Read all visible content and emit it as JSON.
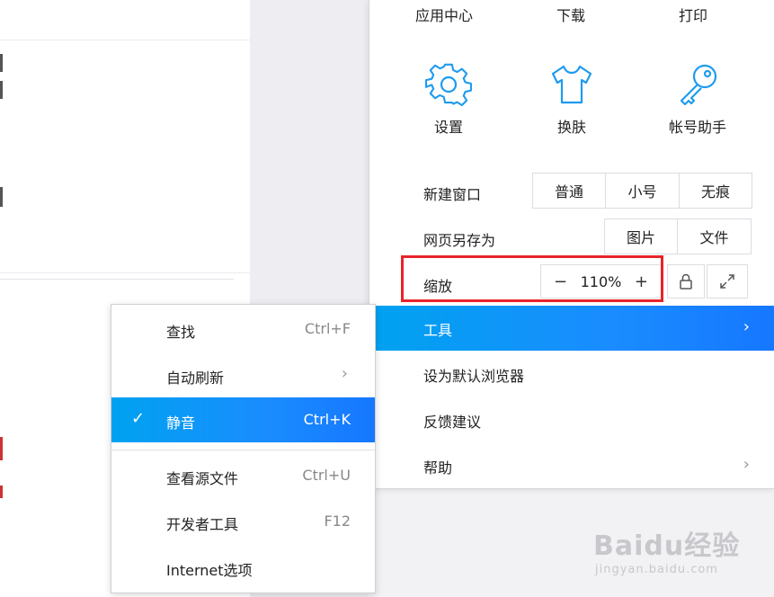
{
  "top_row": [
    {
      "label": "应用中心"
    },
    {
      "label": "下载"
    },
    {
      "label": "打印"
    }
  ],
  "icon_row": [
    {
      "label": "设置",
      "icon": "gear-icon"
    },
    {
      "label": "换肤",
      "icon": "shirt-icon"
    },
    {
      "label": "帐号助手",
      "icon": "key-icon"
    }
  ],
  "new_window": {
    "label": "新建窗口",
    "options": [
      "普通",
      "小号",
      "无痕"
    ]
  },
  "save_as": {
    "label": "网页另存为",
    "options": [
      "图片",
      "文件"
    ]
  },
  "zoom": {
    "label": "缩放",
    "minus": "−",
    "value": "110%",
    "plus": "+"
  },
  "menu_items": [
    {
      "label": "工具",
      "arrow": "›"
    },
    {
      "label": "设为默认浏览器"
    },
    {
      "label": "反馈建议"
    },
    {
      "label": "帮助",
      "arrow": "›"
    }
  ],
  "sub_menu": [
    {
      "label": "查找",
      "shortcut": "Ctrl+F"
    },
    {
      "label": "自动刷新",
      "arrow": "›"
    },
    {
      "label": "静音",
      "shortcut": "Ctrl+K",
      "check": "✓"
    },
    {
      "label": "查看源文件",
      "shortcut": "Ctrl+U"
    },
    {
      "label": "开发者工具",
      "shortcut": "F12"
    },
    {
      "label": "Internet选项"
    }
  ],
  "watermark": {
    "brand": "Baidu经验",
    "url": "jingyan.baidu.com"
  },
  "colors": {
    "accent": "#1a8cff",
    "icon": "#1e9bef",
    "highlight": "#e8232a"
  }
}
